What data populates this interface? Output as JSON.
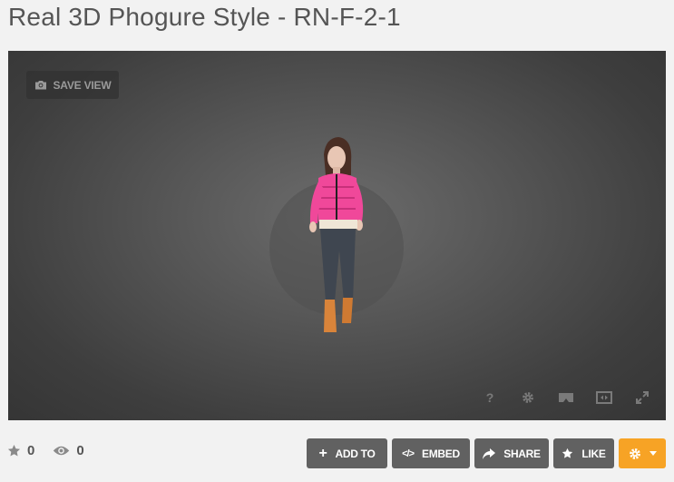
{
  "page": {
    "title": "Real 3D Phogure Style - RN-F-2-1"
  },
  "viewer": {
    "save_view_label": "SAVE VIEW",
    "help_label": "?",
    "tools": [
      "help-icon",
      "settings-icon",
      "vr-icon",
      "fit-view-icon",
      "fullscreen-icon"
    ]
  },
  "stats": {
    "likes": "0",
    "views": "0"
  },
  "actions": {
    "add_to": "ADD TO",
    "embed": "EMBED",
    "share": "SHARE",
    "like": "LIKE"
  },
  "colors": {
    "accent": "#f7a325",
    "button": "#616161"
  }
}
